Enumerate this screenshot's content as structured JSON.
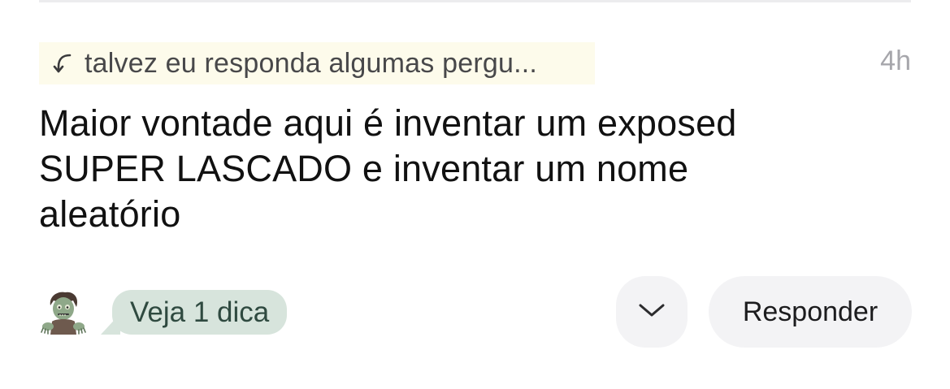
{
  "post": {
    "reply_context": "talvez eu responda algumas pergu...",
    "timestamp": "4h",
    "message_lines": [
      "Maior vontade aqui é inventar um exposed",
      "SUPER LASCADO e inventar um nome",
      "aleatório"
    ],
    "avatar_icon": "zombie-emoji-icon",
    "tip_label": "Veja 1 dica"
  },
  "actions": {
    "expand_icon": "chevron-down-icon",
    "respond_label": "Responder"
  },
  "colors": {
    "reply_context_bg": "#fdfbeb",
    "tip_bubble_bg": "#d7e4dc",
    "button_bg": "#f3f3f5",
    "timestamp": "#a6a6ab"
  }
}
